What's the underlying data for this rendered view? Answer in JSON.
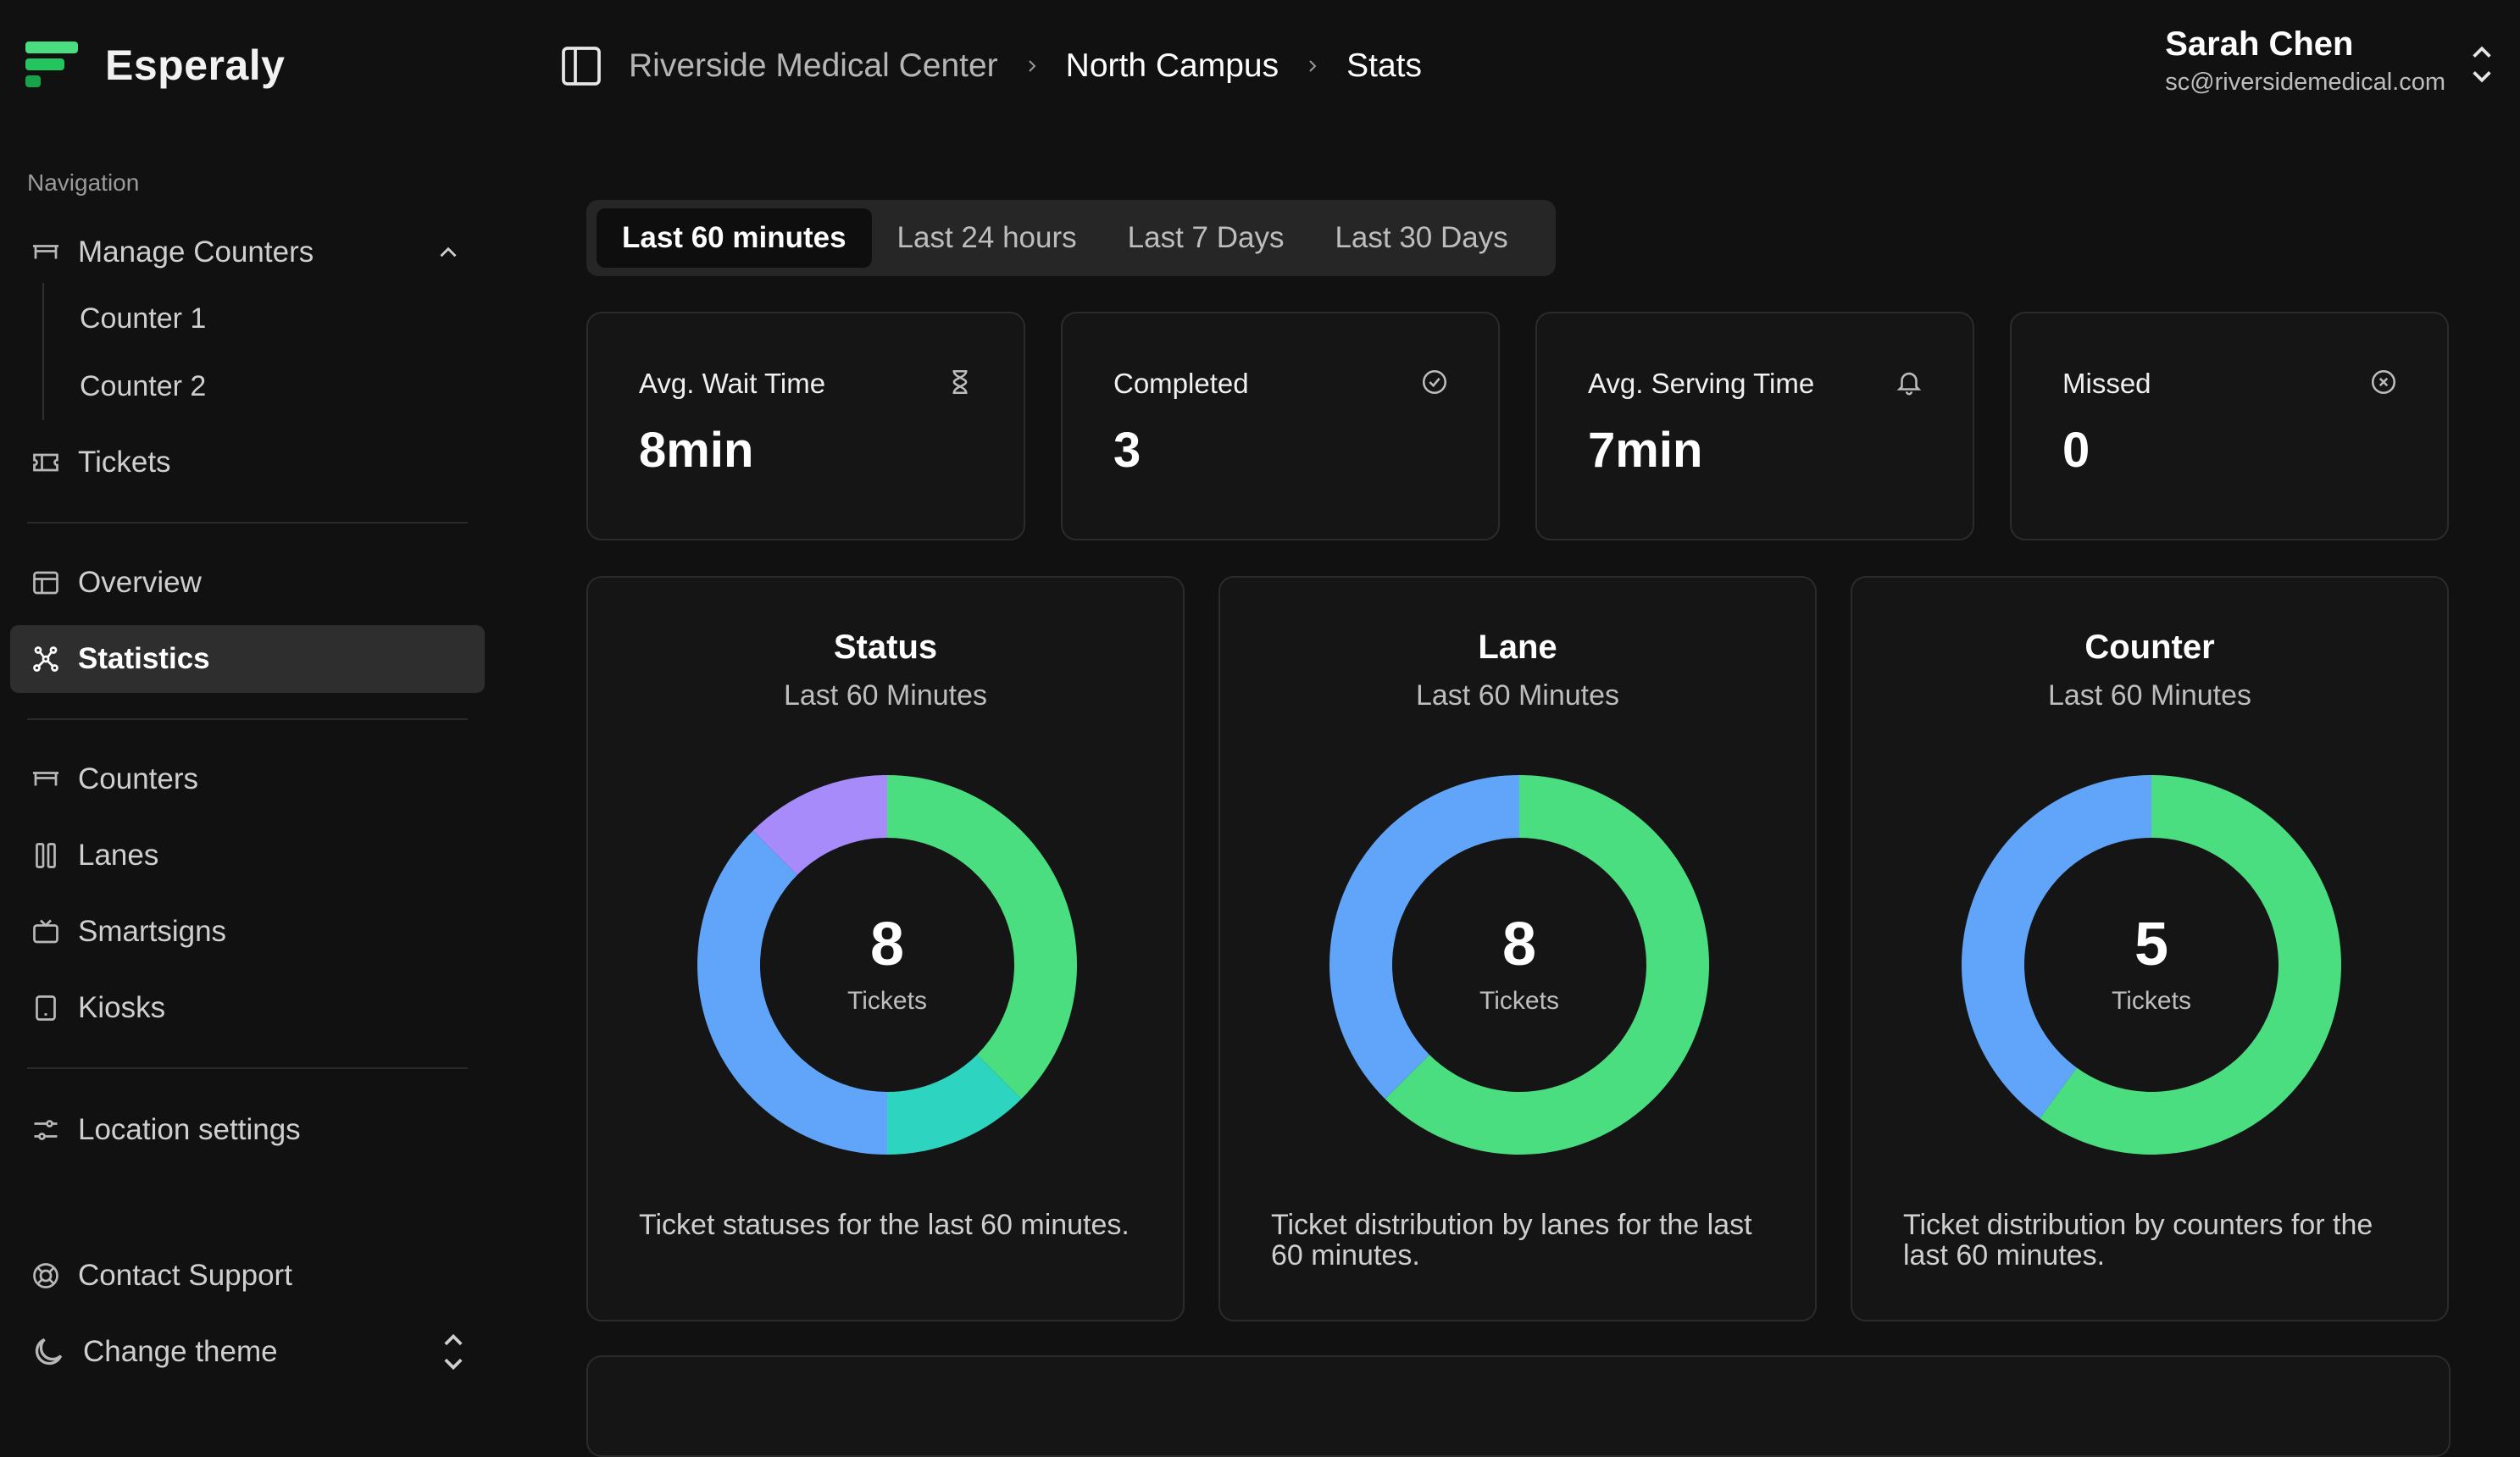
{
  "app": {
    "name": "Esperaly",
    "brand_color": "#4ade80"
  },
  "sidebar": {
    "heading": "Navigation",
    "manage_counters": {
      "label": "Manage Counters",
      "icon": "counter-icon",
      "expanded": true,
      "children": [
        {
          "label": "Counter 1"
        },
        {
          "label": "Counter 2"
        }
      ]
    },
    "items": [
      {
        "label": "Tickets",
        "icon": "ticket-icon"
      },
      {
        "label": "Overview",
        "icon": "layout-icon"
      },
      {
        "label": "Statistics",
        "icon": "graph-icon",
        "active": true
      },
      {
        "label": "Counters",
        "icon": "counter-icon"
      },
      {
        "label": "Lanes",
        "icon": "columns-icon"
      },
      {
        "label": "Smartsigns",
        "icon": "tv-icon"
      },
      {
        "label": "Kiosks",
        "icon": "tablet-icon"
      },
      {
        "label": "Location settings",
        "icon": "sliders-icon"
      },
      {
        "label": "Contact Support",
        "icon": "lifebuoy-icon"
      },
      {
        "label": "Change theme",
        "icon": "moon-icon"
      }
    ]
  },
  "header": {
    "breadcrumbs": [
      "Riverside Medical Center",
      "North Campus",
      "Stats"
    ],
    "user": {
      "name": "Sarah Chen",
      "email": "sc@riversidemedical.com"
    }
  },
  "range_tabs": [
    {
      "label": "Last 60 minutes",
      "active": true
    },
    {
      "label": "Last 24 hours"
    },
    {
      "label": "Last 7 Days"
    },
    {
      "label": "Last 30 Days"
    }
  ],
  "stats": [
    {
      "label": "Avg. Wait Time",
      "value": "8min",
      "icon": "hourglass-icon"
    },
    {
      "label": "Completed",
      "value": "3",
      "icon": "check-circle-icon"
    },
    {
      "label": "Avg. Serving Time",
      "value": "7min",
      "icon": "bell-icon"
    },
    {
      "label": "Missed",
      "value": "0",
      "icon": "x-circle-icon"
    }
  ],
  "chart_data": [
    {
      "type": "pie",
      "donut": true,
      "title": "Status",
      "subtitle": "Last 60 Minutes",
      "center_value": "8",
      "center_label": "Tickets",
      "description": "Ticket statuses for the last 60 minutes.",
      "slices": [
        {
          "value": 3,
          "color": "#4ade80"
        },
        {
          "value": 1,
          "color": "#2dd4bf"
        },
        {
          "value": 3,
          "color": "#60a5fa"
        },
        {
          "value": 1,
          "color": "#a78bfa"
        }
      ]
    },
    {
      "type": "pie",
      "donut": true,
      "title": "Lane",
      "subtitle": "Last 60 Minutes",
      "center_value": "8",
      "center_label": "Tickets",
      "description": "Ticket distribution by lanes for the last 60 minutes.",
      "slices": [
        {
          "value": 5,
          "color": "#4ade80"
        },
        {
          "value": 3,
          "color": "#60a5fa"
        }
      ]
    },
    {
      "type": "pie",
      "donut": true,
      "title": "Counter",
      "subtitle": "Last 60 Minutes",
      "center_value": "5",
      "center_label": "Tickets",
      "description": "Ticket distribution by counters for the last 60 minutes.",
      "slices": [
        {
          "value": 3,
          "color": "#4ade80"
        },
        {
          "value": 2,
          "color": "#60a5fa"
        }
      ]
    }
  ]
}
